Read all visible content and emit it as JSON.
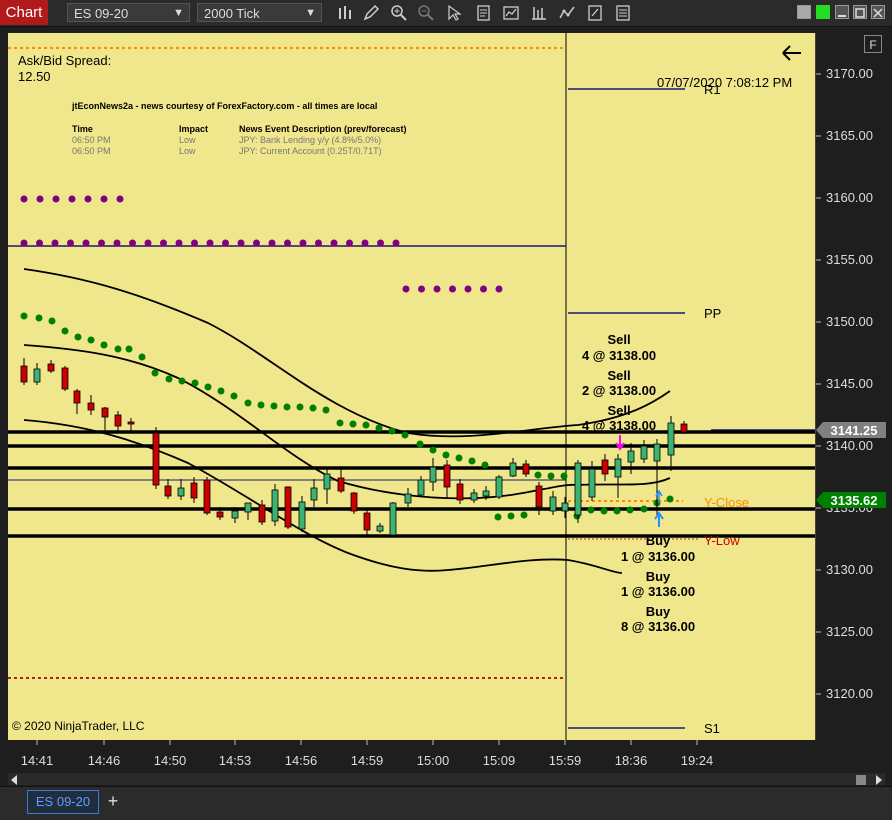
{
  "toolbar": {
    "chart_label": "Chart",
    "instrument": "ES 09-20",
    "interval": "2000 Tick"
  },
  "overlay": {
    "spread_label": "Ask/Bid Spread:",
    "spread_value": "12.50",
    "timestamp": "07/07/2020 7:08:12 PM",
    "copyright": "© 2020 NinjaTrader, LLC",
    "news_title": "jtEconNews2a - news courtesy of ForexFactory.com - all times are local",
    "news_headers": [
      "Time",
      "Impact",
      "News Event Description (prev/forecast)"
    ],
    "news_rows": [
      [
        "06:50 PM",
        "Low",
        "JPY: Bank Lending y/y (4.8%/5.0%)"
      ],
      [
        "06:50 PM",
        "Low",
        "JPY: Current Account (0.25T/0.71T)"
      ]
    ]
  },
  "levels": {
    "r1": "R1",
    "pp": "PP",
    "s1": "S1",
    "y_close": "Y-Close",
    "y_low": "Y-Low"
  },
  "trades": {
    "sells": [
      [
        "Sell",
        "4 @ 3138.00"
      ],
      [
        "Sell",
        "2 @ 3138.00"
      ],
      [
        "Sell",
        "4 @ 3138.00"
      ]
    ],
    "buys": [
      [
        "Buy",
        "1 @ 3136.00"
      ],
      [
        "Buy",
        "1 @ 3136.00"
      ],
      [
        "Buy",
        "8 @ 3136.00"
      ]
    ]
  },
  "price_axis": {
    "ticks": [
      "3170.00",
      "3165.00",
      "3160.00",
      "3155.00",
      "3150.00",
      "3145.00",
      "3140.00",
      "3135.00",
      "3130.00",
      "3125.00",
      "3120.00"
    ],
    "badge_grey": "3141.25",
    "badge_green": "3135.62"
  },
  "time_axis": {
    "ticks": [
      "14:41",
      "14:46",
      "14:50",
      "14:53",
      "14:56",
      "14:59",
      "15:00",
      "15:09",
      "15:59",
      "18:36",
      "19:24"
    ]
  },
  "tabs": {
    "active": "ES 09-20",
    "add_label": "+"
  },
  "panel_button": "F",
  "colors": {
    "chart_bg": "#f0e68c",
    "up_candle": "#3cb371",
    "down_candle": "#cc0000",
    "dots_green": "#008000",
    "dots_purple": "#800080",
    "badge_green": "#008000",
    "badge_grey": "#808080",
    "y_close": "#ff8c00",
    "y_low": "#cc0000"
  },
  "icons": [
    "bar-chart-icon",
    "pencil-icon",
    "zoom-in-icon",
    "zoom-out-icon",
    "pointer-icon",
    "properties-icon",
    "strategy-icon",
    "indicator-icon",
    "templates-icon",
    "data-box-icon"
  ]
}
